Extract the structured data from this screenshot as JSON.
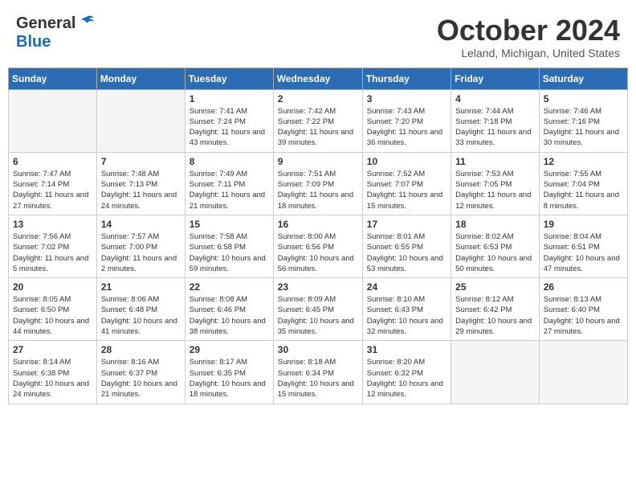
{
  "header": {
    "logo": {
      "general": "General",
      "blue": "Blue"
    },
    "title": "October 2024",
    "location": "Leland, Michigan, United States"
  },
  "weekdays": [
    "Sunday",
    "Monday",
    "Tuesday",
    "Wednesday",
    "Thursday",
    "Friday",
    "Saturday"
  ],
  "weeks": [
    [
      {
        "day": "",
        "info": ""
      },
      {
        "day": "",
        "info": ""
      },
      {
        "day": "1",
        "info": "Sunrise: 7:41 AM\nSunset: 7:24 PM\nDaylight: 11 hours and 43 minutes."
      },
      {
        "day": "2",
        "info": "Sunrise: 7:42 AM\nSunset: 7:22 PM\nDaylight: 11 hours and 39 minutes."
      },
      {
        "day": "3",
        "info": "Sunrise: 7:43 AM\nSunset: 7:20 PM\nDaylight: 11 hours and 36 minutes."
      },
      {
        "day": "4",
        "info": "Sunrise: 7:44 AM\nSunset: 7:18 PM\nDaylight: 11 hours and 33 minutes."
      },
      {
        "day": "5",
        "info": "Sunrise: 7:46 AM\nSunset: 7:16 PM\nDaylight: 11 hours and 30 minutes."
      }
    ],
    [
      {
        "day": "6",
        "info": "Sunrise: 7:47 AM\nSunset: 7:14 PM\nDaylight: 11 hours and 27 minutes."
      },
      {
        "day": "7",
        "info": "Sunrise: 7:48 AM\nSunset: 7:13 PM\nDaylight: 11 hours and 24 minutes."
      },
      {
        "day": "8",
        "info": "Sunrise: 7:49 AM\nSunset: 7:11 PM\nDaylight: 11 hours and 21 minutes."
      },
      {
        "day": "9",
        "info": "Sunrise: 7:51 AM\nSunset: 7:09 PM\nDaylight: 11 hours and 18 minutes."
      },
      {
        "day": "10",
        "info": "Sunrise: 7:52 AM\nSunset: 7:07 PM\nDaylight: 11 hours and 15 minutes."
      },
      {
        "day": "11",
        "info": "Sunrise: 7:53 AM\nSunset: 7:05 PM\nDaylight: 11 hours and 12 minutes."
      },
      {
        "day": "12",
        "info": "Sunrise: 7:55 AM\nSunset: 7:04 PM\nDaylight: 11 hours and 8 minutes."
      }
    ],
    [
      {
        "day": "13",
        "info": "Sunrise: 7:56 AM\nSunset: 7:02 PM\nDaylight: 11 hours and 5 minutes."
      },
      {
        "day": "14",
        "info": "Sunrise: 7:57 AM\nSunset: 7:00 PM\nDaylight: 11 hours and 2 minutes."
      },
      {
        "day": "15",
        "info": "Sunrise: 7:58 AM\nSunset: 6:58 PM\nDaylight: 10 hours and 59 minutes."
      },
      {
        "day": "16",
        "info": "Sunrise: 8:00 AM\nSunset: 6:56 PM\nDaylight: 10 hours and 56 minutes."
      },
      {
        "day": "17",
        "info": "Sunrise: 8:01 AM\nSunset: 6:55 PM\nDaylight: 10 hours and 53 minutes."
      },
      {
        "day": "18",
        "info": "Sunrise: 8:02 AM\nSunset: 6:53 PM\nDaylight: 10 hours and 50 minutes."
      },
      {
        "day": "19",
        "info": "Sunrise: 8:04 AM\nSunset: 6:51 PM\nDaylight: 10 hours and 47 minutes."
      }
    ],
    [
      {
        "day": "20",
        "info": "Sunrise: 8:05 AM\nSunset: 6:50 PM\nDaylight: 10 hours and 44 minutes."
      },
      {
        "day": "21",
        "info": "Sunrise: 8:06 AM\nSunset: 6:48 PM\nDaylight: 10 hours and 41 minutes."
      },
      {
        "day": "22",
        "info": "Sunrise: 8:08 AM\nSunset: 6:46 PM\nDaylight: 10 hours and 38 minutes."
      },
      {
        "day": "23",
        "info": "Sunrise: 8:09 AM\nSunset: 6:45 PM\nDaylight: 10 hours and 35 minutes."
      },
      {
        "day": "24",
        "info": "Sunrise: 8:10 AM\nSunset: 6:43 PM\nDaylight: 10 hours and 32 minutes."
      },
      {
        "day": "25",
        "info": "Sunrise: 8:12 AM\nSunset: 6:42 PM\nDaylight: 10 hours and 29 minutes."
      },
      {
        "day": "26",
        "info": "Sunrise: 8:13 AM\nSunset: 6:40 PM\nDaylight: 10 hours and 27 minutes."
      }
    ],
    [
      {
        "day": "27",
        "info": "Sunrise: 8:14 AM\nSunset: 6:38 PM\nDaylight: 10 hours and 24 minutes."
      },
      {
        "day": "28",
        "info": "Sunrise: 8:16 AM\nSunset: 6:37 PM\nDaylight: 10 hours and 21 minutes."
      },
      {
        "day": "29",
        "info": "Sunrise: 8:17 AM\nSunset: 6:35 PM\nDaylight: 10 hours and 18 minutes."
      },
      {
        "day": "30",
        "info": "Sunrise: 8:18 AM\nSunset: 6:34 PM\nDaylight: 10 hours and 15 minutes."
      },
      {
        "day": "31",
        "info": "Sunrise: 8:20 AM\nSunset: 6:32 PM\nDaylight: 10 hours and 12 minutes."
      },
      {
        "day": "",
        "info": ""
      },
      {
        "day": "",
        "info": ""
      }
    ]
  ]
}
